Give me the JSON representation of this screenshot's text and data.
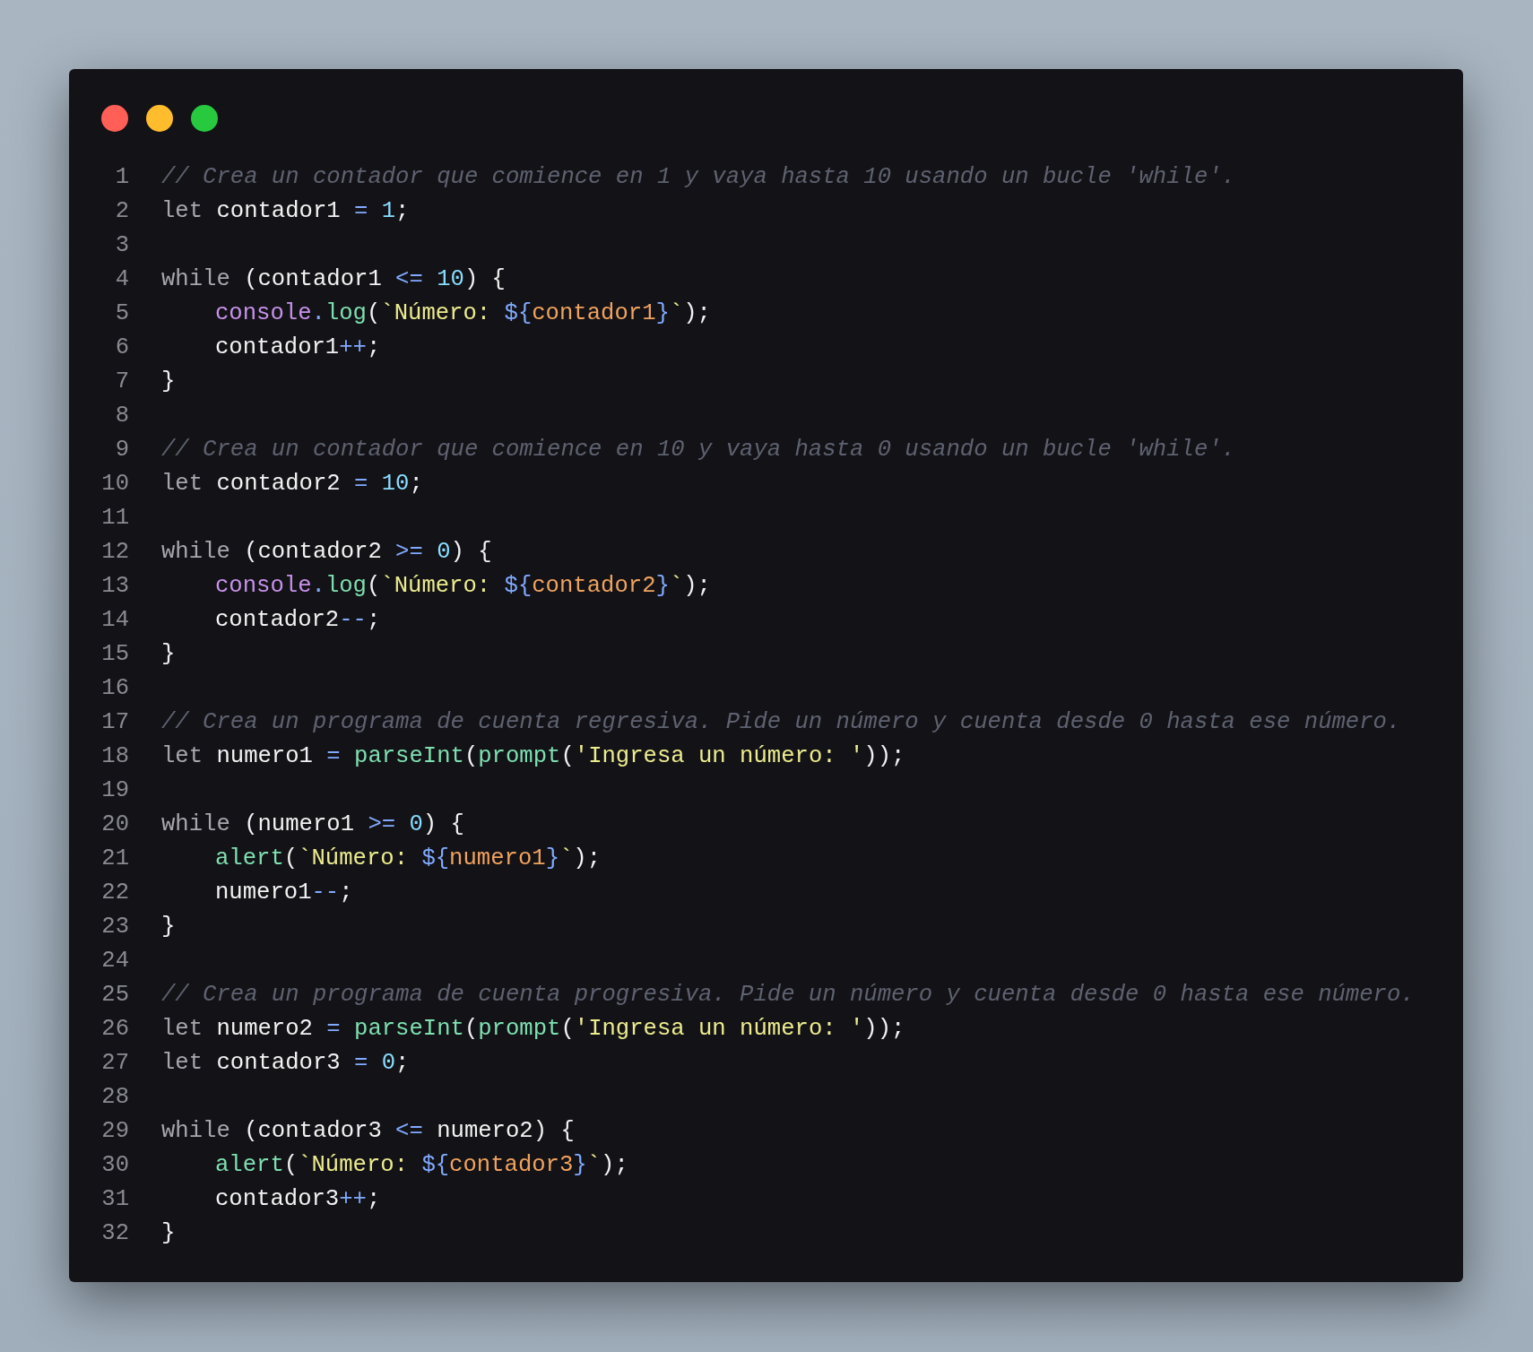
{
  "editor": {
    "lines": [
      {
        "number": "1",
        "indented": false,
        "tokens": [
          {
            "text": "// Crea un contador que comience en 1 y vaya hasta 10 usando un bucle 'while'.",
            "kind": "comment"
          }
        ]
      },
      {
        "number": "2",
        "indented": false,
        "tokens": [
          {
            "text": "let",
            "kind": "keyword"
          },
          {
            "text": " contador1 ",
            "kind": "variable"
          },
          {
            "text": "= ",
            "kind": "operator"
          },
          {
            "text": "1",
            "kind": "number"
          },
          {
            "text": ";",
            "kind": "punct"
          }
        ]
      },
      {
        "number": "3"
      },
      {
        "number": "4",
        "indented": false,
        "tokens": [
          {
            "text": "while",
            "kind": "keyword"
          },
          {
            "text": " (contador1 ",
            "kind": "variable"
          },
          {
            "text": "<= ",
            "kind": "operator"
          },
          {
            "text": "10",
            "kind": "number"
          },
          {
            "text": ") {",
            "kind": "punct"
          }
        ]
      },
      {
        "number": "5",
        "indented": true,
        "tokens": [
          {
            "text": "console",
            "kind": "object"
          },
          {
            "text": ".",
            "kind": "operator"
          },
          {
            "text": "log",
            "kind": "function"
          },
          {
            "text": "(",
            "kind": "punct"
          },
          {
            "text": "`Número: ",
            "kind": "string"
          },
          {
            "text": "${",
            "kind": "interp"
          },
          {
            "text": "contador1",
            "kind": "interpvar"
          },
          {
            "text": "}",
            "kind": "interp"
          },
          {
            "text": "`",
            "kind": "string"
          },
          {
            "text": ");",
            "kind": "punct"
          }
        ]
      },
      {
        "number": "6",
        "indented": true,
        "tokens": [
          {
            "text": "contador1",
            "kind": "variable"
          },
          {
            "text": "++",
            "kind": "operator"
          },
          {
            "text": ";",
            "kind": "punct"
          }
        ]
      },
      {
        "number": "7",
        "indented": false,
        "tokens": [
          {
            "text": "}",
            "kind": "punct"
          }
        ]
      },
      {
        "number": "8"
      },
      {
        "number": "9",
        "indented": false,
        "tokens": [
          {
            "text": "// Crea un contador que comience en 10 y vaya hasta 0 usando un bucle 'while'.",
            "kind": "comment"
          }
        ]
      },
      {
        "number": "10",
        "indented": false,
        "tokens": [
          {
            "text": "let",
            "kind": "keyword"
          },
          {
            "text": " contador2 ",
            "kind": "variable"
          },
          {
            "text": "= ",
            "kind": "operator"
          },
          {
            "text": "10",
            "kind": "number"
          },
          {
            "text": ";",
            "kind": "punct"
          }
        ]
      },
      {
        "number": "11"
      },
      {
        "number": "12",
        "indented": false,
        "tokens": [
          {
            "text": "while",
            "kind": "keyword"
          },
          {
            "text": " (contador2 ",
            "kind": "variable"
          },
          {
            "text": ">= ",
            "kind": "operator"
          },
          {
            "text": "0",
            "kind": "number"
          },
          {
            "text": ") {",
            "kind": "punct"
          }
        ]
      },
      {
        "number": "13",
        "indented": true,
        "tokens": [
          {
            "text": "console",
            "kind": "object"
          },
          {
            "text": ".",
            "kind": "operator"
          },
          {
            "text": "log",
            "kind": "function"
          },
          {
            "text": "(",
            "kind": "punct"
          },
          {
            "text": "`Número: ",
            "kind": "string"
          },
          {
            "text": "${",
            "kind": "interp"
          },
          {
            "text": "contador2",
            "kind": "interpvar"
          },
          {
            "text": "}",
            "kind": "interp"
          },
          {
            "text": "`",
            "kind": "string"
          },
          {
            "text": ");",
            "kind": "punct"
          }
        ]
      },
      {
        "number": "14",
        "indented": true,
        "tokens": [
          {
            "text": "contador2",
            "kind": "variable"
          },
          {
            "text": "--",
            "kind": "operator"
          },
          {
            "text": ";",
            "kind": "punct"
          }
        ]
      },
      {
        "number": "15",
        "indented": false,
        "tokens": [
          {
            "text": "}",
            "kind": "punct"
          }
        ]
      },
      {
        "number": "16"
      },
      {
        "number": "17",
        "indented": false,
        "tokens": [
          {
            "text": "// Crea un programa de cuenta regresiva. Pide un número y cuenta desde 0 hasta ese número.",
            "kind": "comment"
          }
        ]
      },
      {
        "number": "18",
        "indented": false,
        "tokens": [
          {
            "text": "let",
            "kind": "keyword"
          },
          {
            "text": " numero1 ",
            "kind": "variable"
          },
          {
            "text": "= ",
            "kind": "operator"
          },
          {
            "text": "parseInt",
            "kind": "function"
          },
          {
            "text": "(",
            "kind": "punct"
          },
          {
            "text": "prompt",
            "kind": "function"
          },
          {
            "text": "(",
            "kind": "punct"
          },
          {
            "text": "'Ingresa un número: '",
            "kind": "string"
          },
          {
            "text": "));",
            "kind": "punct"
          }
        ]
      },
      {
        "number": "19"
      },
      {
        "number": "20",
        "indented": false,
        "tokens": [
          {
            "text": "while",
            "kind": "keyword"
          },
          {
            "text": " (numero1 ",
            "kind": "variable"
          },
          {
            "text": ">= ",
            "kind": "operator"
          },
          {
            "text": "0",
            "kind": "number"
          },
          {
            "text": ") {",
            "kind": "punct"
          }
        ]
      },
      {
        "number": "21",
        "indented": true,
        "tokens": [
          {
            "text": "alert",
            "kind": "function"
          },
          {
            "text": "(",
            "kind": "punct"
          },
          {
            "text": "`Número: ",
            "kind": "string"
          },
          {
            "text": "${",
            "kind": "interp"
          },
          {
            "text": "numero1",
            "kind": "interpvar"
          },
          {
            "text": "}",
            "kind": "interp"
          },
          {
            "text": "`",
            "kind": "string"
          },
          {
            "text": ");",
            "kind": "punct"
          }
        ]
      },
      {
        "number": "22",
        "indented": true,
        "tokens": [
          {
            "text": "numero1",
            "kind": "variable"
          },
          {
            "text": "--",
            "kind": "operator"
          },
          {
            "text": ";",
            "kind": "punct"
          }
        ]
      },
      {
        "number": "23",
        "indented": false,
        "tokens": [
          {
            "text": "}",
            "kind": "punct"
          }
        ]
      },
      {
        "number": "24"
      },
      {
        "number": "25",
        "indented": false,
        "tokens": [
          {
            "text": "// Crea un programa de cuenta progresiva. Pide un número y cuenta desde 0 hasta ese número.",
            "kind": "comment"
          }
        ]
      },
      {
        "number": "26",
        "indented": false,
        "tokens": [
          {
            "text": "let",
            "kind": "keyword"
          },
          {
            "text": " numero2 ",
            "kind": "variable"
          },
          {
            "text": "= ",
            "kind": "operator"
          },
          {
            "text": "parseInt",
            "kind": "function"
          },
          {
            "text": "(",
            "kind": "punct"
          },
          {
            "text": "prompt",
            "kind": "function"
          },
          {
            "text": "(",
            "kind": "punct"
          },
          {
            "text": "'Ingresa un número: '",
            "kind": "string"
          },
          {
            "text": "));",
            "kind": "punct"
          }
        ]
      },
      {
        "number": "27",
        "indented": false,
        "tokens": [
          {
            "text": "let",
            "kind": "keyword"
          },
          {
            "text": " contador3 ",
            "kind": "variable"
          },
          {
            "text": "= ",
            "kind": "operator"
          },
          {
            "text": "0",
            "kind": "number"
          },
          {
            "text": ";",
            "kind": "punct"
          }
        ]
      },
      {
        "number": "28"
      },
      {
        "number": "29",
        "indented": false,
        "tokens": [
          {
            "text": "while",
            "kind": "keyword"
          },
          {
            "text": " (contador3 ",
            "kind": "variable"
          },
          {
            "text": "<=",
            "kind": "operator"
          },
          {
            "text": " numero2) {",
            "kind": "variable"
          }
        ]
      },
      {
        "number": "30",
        "indented": true,
        "tokens": [
          {
            "text": "alert",
            "kind": "function"
          },
          {
            "text": "(",
            "kind": "punct"
          },
          {
            "text": "`Número: ",
            "kind": "string"
          },
          {
            "text": "${",
            "kind": "interp"
          },
          {
            "text": "contador3",
            "kind": "interpvar"
          },
          {
            "text": "}",
            "kind": "interp"
          },
          {
            "text": "`",
            "kind": "string"
          },
          {
            "text": ");",
            "kind": "punct"
          }
        ]
      },
      {
        "number": "31",
        "indented": true,
        "tokens": [
          {
            "text": "contador3",
            "kind": "variable"
          },
          {
            "text": "++",
            "kind": "operator"
          },
          {
            "text": ";",
            "kind": "punct"
          }
        ]
      },
      {
        "number": "32",
        "indented": false,
        "tokens": [
          {
            "text": "}",
            "kind": "punct"
          }
        ]
      }
    ]
  }
}
